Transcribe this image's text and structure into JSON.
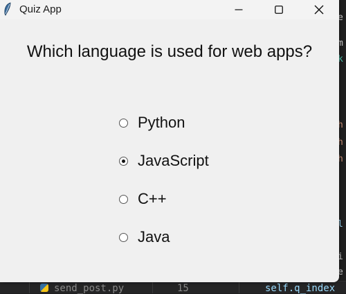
{
  "window": {
    "title": "Quiz App",
    "icon": "feather-icon"
  },
  "controls": {
    "minimize_icon": "minimize-icon",
    "maximize_icon": "maximize-icon",
    "close_icon": "close-icon"
  },
  "quiz": {
    "question": "Which language is used for web apps?",
    "options": [
      {
        "label": "Python",
        "selected": false
      },
      {
        "label": "JavaScript",
        "selected": true
      },
      {
        "label": "C++",
        "selected": false
      },
      {
        "label": "Java",
        "selected": false
      }
    ]
  },
  "background_editor": {
    "tab_file": "send_post.py",
    "line_number": "15",
    "code_fragment": "self.q_index"
  },
  "colors": {
    "window_bg": "#f0f0f0",
    "editor_bg": "#1f1f1f",
    "code_text": "#9cdcfe"
  }
}
